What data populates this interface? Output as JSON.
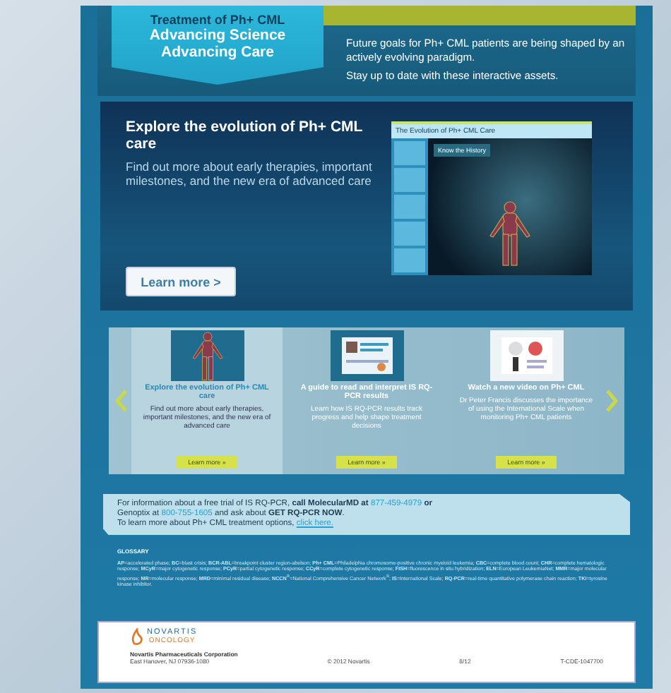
{
  "header": {
    "kicker": "Treatment of Ph+ CML",
    "headline": [
      "Advancing Science",
      "Advancing Care"
    ],
    "intro": [
      "Future goals for Ph+ CML patients are being shaped by an actively evolving paradigm.",
      "Stay up to date with these interactive assets."
    ]
  },
  "hero": {
    "title": "Explore the evolution of Ph+ CML care",
    "text": "Find out more about early therapies, important milestones, and the new era of advanced care",
    "button": "Learn more >",
    "preview": {
      "title": "The Evolution of Ph+ CML Care",
      "popup": "Know the History"
    }
  },
  "carousel": {
    "items": [
      {
        "kind": "app",
        "title": "Explore the evolution of Ph+ CML care",
        "text": "Find out more about early therapies, important milestones, and the new era of advanced care",
        "button": "Learn more »",
        "selected": true
      },
      {
        "kind": "report",
        "title": "A guide to read and interpret IS RQ-PCR results",
        "text": "Learn how IS RQ-PCR results track progress and help shape treatment decisions",
        "button": "Learn more »",
        "selected": false
      },
      {
        "kind": "video",
        "title": "Watch a new video on Ph+ CML",
        "text": "Dr Peter Francis discusses the importance of using the International Scale when monitoring Ph+ CML patients",
        "button": "Learn more »",
        "selected": false
      }
    ]
  },
  "info": {
    "lines": [
      "For information about a free trial of IS RQ-PCR, **call MolecularMD at** ",
      "Genoptix at ",
      " and ask about **GET RQ-PCR NOW**.",
      "To learn more about Ph+ CML treatment options, "
    ],
    "phone_1": "877-459-4979",
    "or": " **or**",
    "phone_2": "800-755-1605",
    "link": "click here."
  },
  "glossary": {
    "title": "GLOSSARY",
    "text": "**AP**=accelerated phase; **BC**=blast crisis; **BCR-ABL**=breakpoint cluster region-abelson; **Ph+ CML**=Philadelphia chromosome-positive chronic myeloid leukemia; **CBC**=complete blood count; **CHR**=complete hematologic response; **MCyR**=major cytogenetic response; **PCyR**=partial cytogenetic response; **CCyR**=complete cytogenetic response; **FISH**=fluorescence in situ hybridization; **ELN**=European LeukemiaNet; **MMR**=major molecular response; **MR**=molecular response; **MRD**=minimal residual disease; **NCCN**$^{®}$=National Comprehensive Cancer Network$^{®}$; **IS**=International Scale; **RQ-PCR**=real-time quantitative polymerase chain reaction; **TKI**=tyrosine kinase inhibitor."
  },
  "footer": {
    "logo": "NOVARTIS",
    "logo_sub": "ONCOLOGY",
    "company": "Novartis Pharmaceuticals Corporation",
    "address": "East Hanover, NJ 07936-1080",
    "copyright": "© 2012 Novartis",
    "date": "8/12",
    "code": "T-CDE-1047700"
  }
}
